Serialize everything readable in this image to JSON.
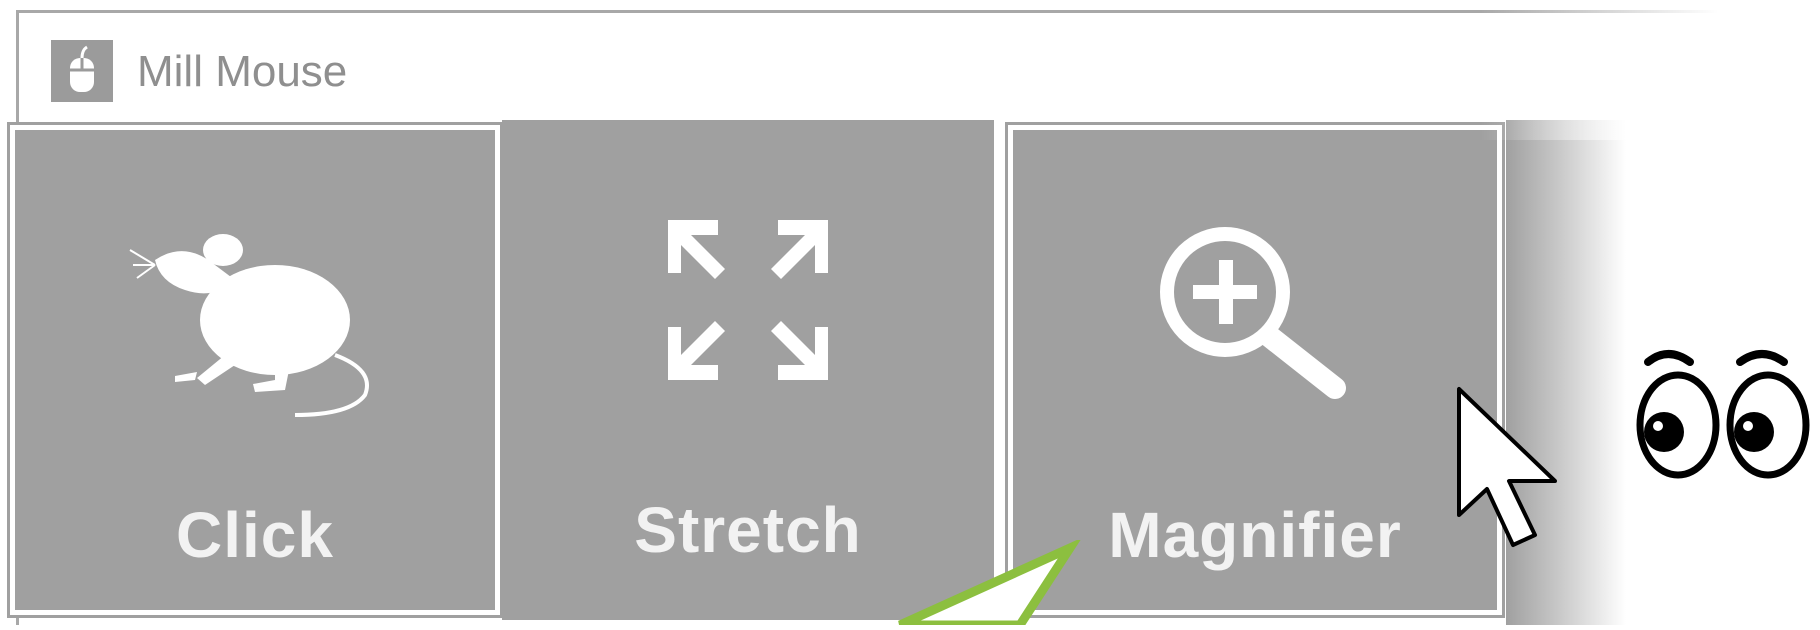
{
  "window": {
    "title": "Mill Mouse",
    "app_icon": "mouse-device-icon"
  },
  "tiles": [
    {
      "id": "click",
      "label": "Click",
      "icon": "mouse-silhouette-icon"
    },
    {
      "id": "stretch",
      "label": "Stretch",
      "icon": "expand-arrows-icon"
    },
    {
      "id": "magnifier",
      "label": "Magnifier",
      "icon": "magnifier-plus-icon"
    }
  ],
  "overlays": {
    "cursor_icon": "arrow-pointer-icon",
    "eyes_icon": "googly-eyes-icon",
    "callout_color": "#8cbf3f"
  },
  "colors": {
    "tile": "#a0a0a0",
    "tile_text": "#f2f2f2",
    "title_text": "#8f8f8f"
  }
}
